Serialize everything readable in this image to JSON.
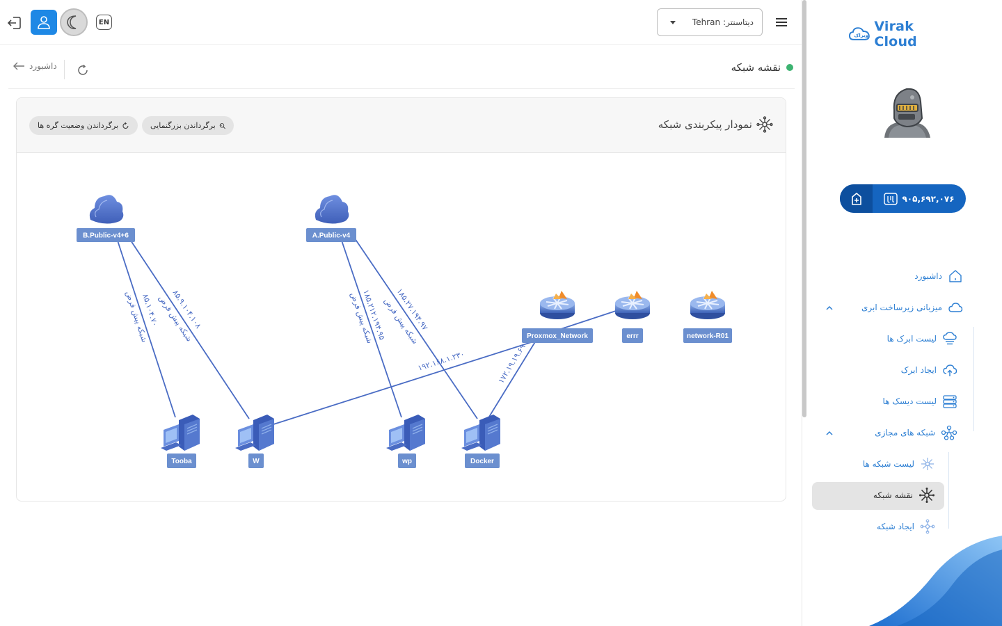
{
  "sidebar": {
    "logo_text": "Virak Cloud",
    "wallet_balance": "۹۰۵,۶۹۲,۰۷۶",
    "menu": {
      "dashboard": "داشبورد",
      "cloud_infra": "میزبانی زیرساخت ابری",
      "cloud_list": "لیست ابرک ها",
      "cloud_create": "ایجاد ابرک",
      "disk_list": "لیست دیسک ها",
      "virtual_networks": "شبکه های مجازی",
      "network_list": "لیست شبکه ها",
      "network_map": "نقشه شبکه",
      "network_create": "ایجاد شبکه"
    }
  },
  "topbar": {
    "lang": "EN",
    "datacenter_label": "دیتاسنتر:",
    "datacenter_value": "Tehran"
  },
  "header": {
    "title": "نقشه شبکه",
    "back": "داشبورد"
  },
  "card": {
    "title": "نمودار پیکربندی شبکه",
    "reset_zoom": "برگرداندن بزرگنمایی",
    "reset_nodes": "برگرداندن وضعیت گره ها"
  },
  "graph": {
    "nodes": {
      "b_public": "B.Public-v4+6",
      "a_public": "A.Public-v4",
      "proxmox": "Proxmox_Network",
      "errr": "errr",
      "network_r01": "network-R01",
      "tooba": "Tooba",
      "w": "W",
      "wp": "wp",
      "docker": "Docker"
    },
    "edges": {
      "b_tooba_ip": "۸۵.۱۰۴.۷۰",
      "b_tooba_type": "شبکه پیش فرض",
      "b_w_ip": "۸۵.۹.۱۰۴.۱۰۸",
      "b_w_type": "شبکه پیش فرض",
      "a_wp_ip": "۱۸۵.۲۱۲.۱۹۴.۹۵",
      "a_wp_type": "شبکه پیش فرض",
      "a_docker_ip": "۱۸۵.۲۷.۱۹۴.۹۷",
      "a_docker_type": "شبکه پیش فرض",
      "proxmox_w_ip": "۱۹۲.۱۶۸.۱.۲۳۰",
      "proxmox_docker_ip": "۱۷۲.۱۹.۱۹.۶۹"
    }
  }
}
